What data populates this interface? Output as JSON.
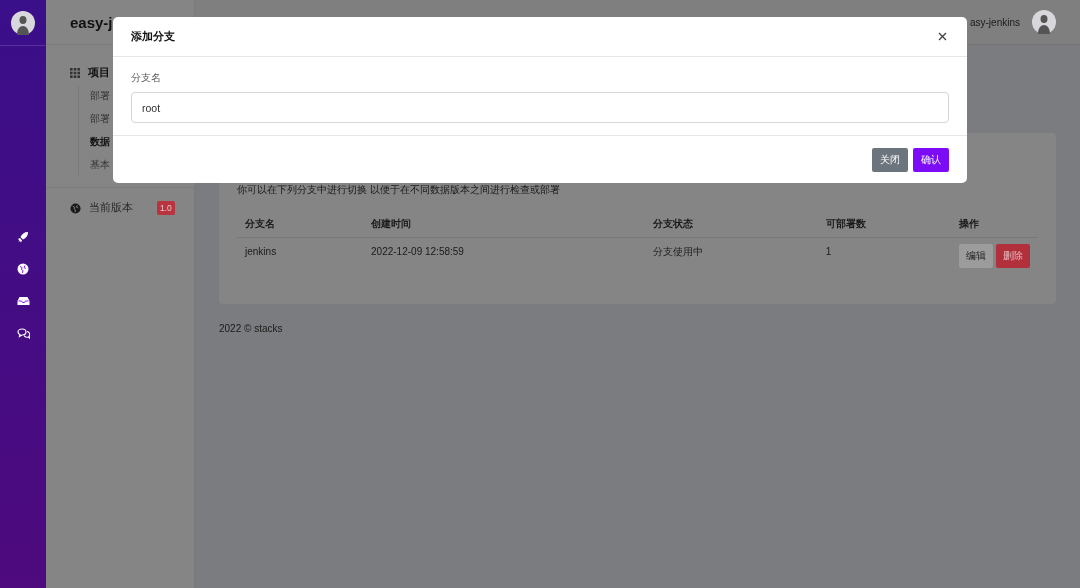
{
  "brand": "easy-j",
  "sidebar": {
    "group": "项目",
    "items": [
      {
        "label": "部署",
        "selected": false
      },
      {
        "label": "部署",
        "selected": false
      },
      {
        "label": "数据",
        "selected": true
      },
      {
        "label": "基本",
        "selected": false
      }
    ],
    "version": {
      "label": "当前版本",
      "badge": "1.0"
    }
  },
  "header": {
    "user": "asy-jenkins"
  },
  "card": {
    "description": "你可以在下列分支中进行切换 以便于在不同数据版本之间进行检查或部署",
    "table": {
      "columns": [
        "分支名",
        "创建时间",
        "分支状态",
        "可部署数",
        "操作"
      ],
      "rows": [
        {
          "cells": [
            "jenkins",
            "2022-12-09 12:58:59",
            "分支使用中",
            "1"
          ],
          "actions": [
            {
              "label": "编辑",
              "kind": "secondary"
            },
            {
              "label": "删除",
              "kind": "danger"
            }
          ]
        }
      ]
    }
  },
  "footer": "2022 © stacks",
  "modal": {
    "title": "添加分支",
    "field": {
      "label": "分支名",
      "value": "root"
    },
    "buttons": [
      {
        "label": "关闭",
        "kind": "secondary"
      },
      {
        "label": "确认",
        "kind": "primary"
      }
    ]
  }
}
